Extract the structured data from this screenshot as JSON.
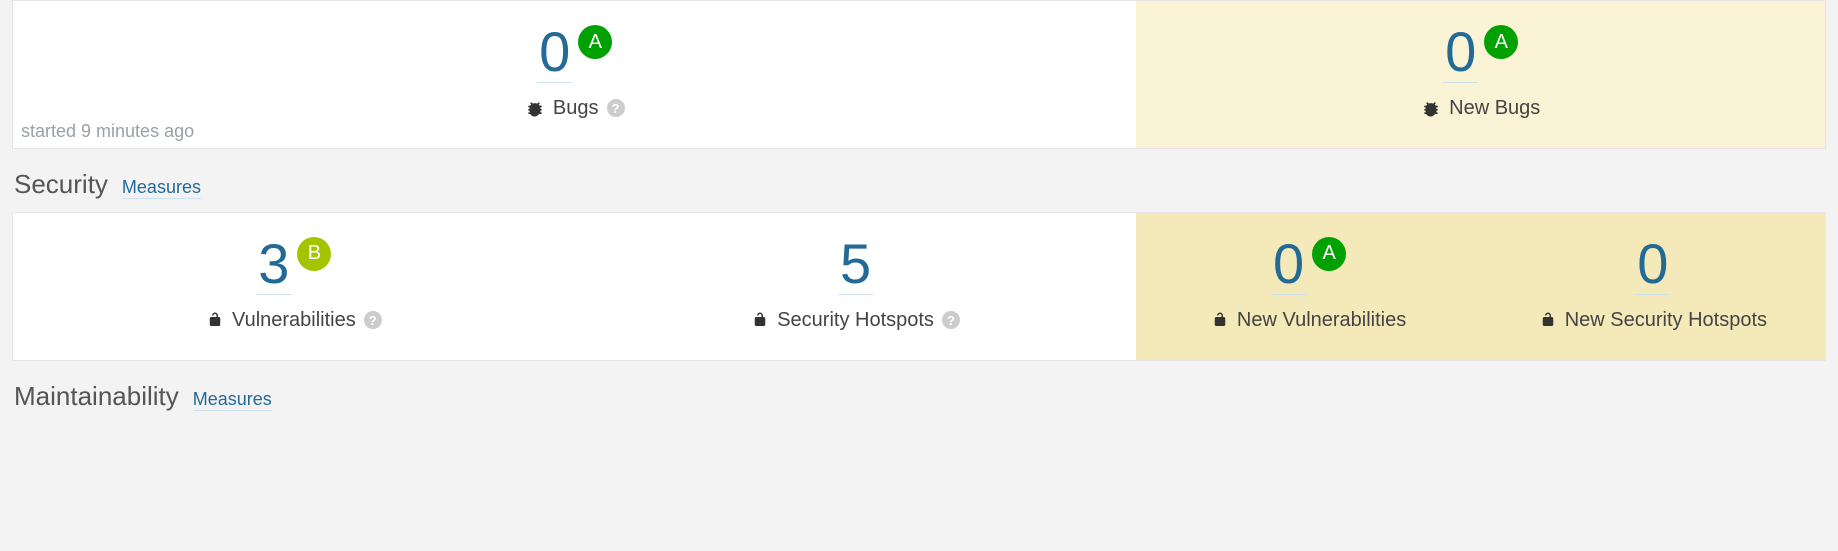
{
  "colors": {
    "link": "#236a97",
    "ratingA": "#00a100",
    "ratingB": "#a4c400"
  },
  "reliability": {
    "started_note": "started 9 minutes ago",
    "bugs": {
      "value": "0",
      "rating": "A",
      "label": "Bugs",
      "has_help": true
    },
    "new_bugs": {
      "value": "0",
      "rating": "A",
      "label": "New Bugs",
      "has_help": false
    }
  },
  "security": {
    "title": "Security",
    "measures_link": "Measures",
    "vuln": {
      "value": "3",
      "rating": "B",
      "label": "Vulnerabilities",
      "has_help": true
    },
    "hotspots": {
      "value": "5",
      "label": "Security Hotspots",
      "has_help": true
    },
    "new_vuln": {
      "value": "0",
      "rating": "A",
      "label": "New Vulnerabilities"
    },
    "new_hotspots": {
      "value": "0",
      "label": "New Security Hotspots"
    }
  },
  "maintainability": {
    "title": "Maintainability",
    "measures_link": "Measures"
  }
}
